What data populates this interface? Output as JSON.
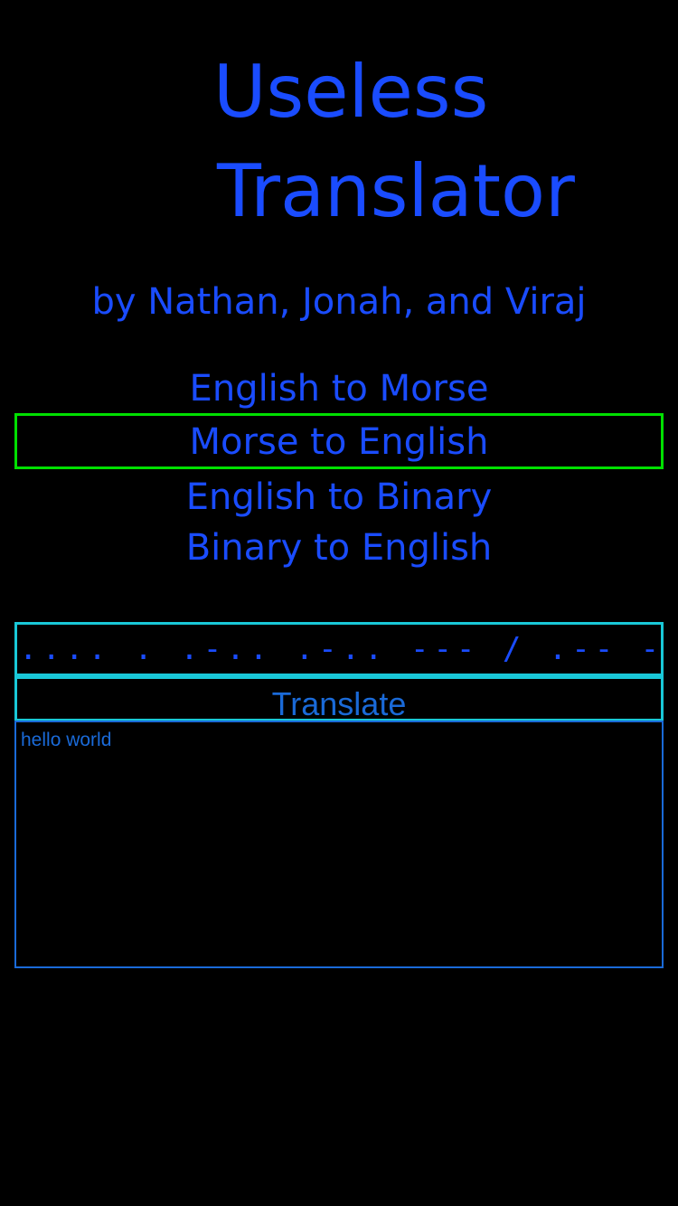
{
  "app": {
    "title_line_1": "Useless",
    "title_line_2": "Translator",
    "byline": "by Nathan, Jonah, and Viraj"
  },
  "modes": [
    {
      "label": "English to Morse",
      "selected": false
    },
    {
      "label": "Morse to English",
      "selected": true
    },
    {
      "label": "English to Binary",
      "selected": false
    },
    {
      "label": "Binary to English",
      "selected": false
    }
  ],
  "input": {
    "value": ".... . .-.. .-.. --- / .-- --- .-"
  },
  "translate_button": {
    "label": "Translate"
  },
  "output": {
    "value": "hello world"
  },
  "colors": {
    "background": "#000000",
    "text": "#1a4cff",
    "selected_border": "#00e000",
    "input_border": "#19c8d8",
    "output_text": "#1a6ad8"
  }
}
